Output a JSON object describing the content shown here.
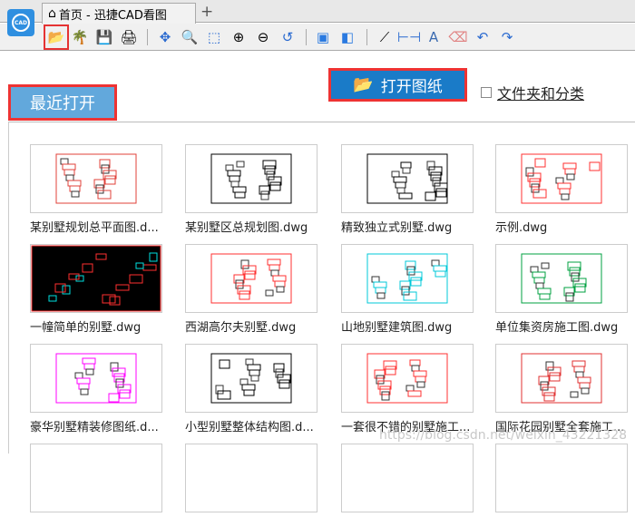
{
  "app": {
    "logo_text": "CAD",
    "tab_title": "首页 - 迅捷CAD看图",
    "add_tab": "+"
  },
  "toolbar": [
    "open-file",
    "palm-tree",
    "save",
    "print",
    "pan",
    "zoom-window",
    "zoom-extents",
    "zoom-in",
    "zoom-out",
    "zoom-previous",
    "3d-box",
    "3d-view",
    "line-measure",
    "dimension",
    "text",
    "eraser",
    "undo",
    "redo"
  ],
  "recent_label": "最近打开",
  "open_button": "打开图纸",
  "folder_checkbox": {
    "label": "文件夹和分类",
    "checked": false
  },
  "files": [
    {
      "name": "某别墅规划总平面图.d...",
      "bg": "#ffffff",
      "color": "#e0403a"
    },
    {
      "name": "某别墅区总规划图.dwg",
      "bg": "#ffffff",
      "color": "#000000"
    },
    {
      "name": "精致独立式别墅.dwg",
      "bg": "#ffffff",
      "color": "#000000"
    },
    {
      "name": "示例.dwg",
      "bg": "#ffffff",
      "color": "#ff3030"
    },
    {
      "name": "一幢简单的别墅.dwg",
      "bg": "#000000",
      "color": "#ff3030"
    },
    {
      "name": "西湖高尔夫别墅.dwg",
      "bg": "#ffffff",
      "color": "#ff3030"
    },
    {
      "name": "山地别墅建筑图.dwg",
      "bg": "#ffffff",
      "color": "#00c8d8"
    },
    {
      "name": "单位集资房施工图.dwg",
      "bg": "#ffffff",
      "color": "#00a040"
    },
    {
      "name": "豪华别墅精装修图纸.d...",
      "bg": "#ffffff",
      "color": "#ff00ff"
    },
    {
      "name": "小型别墅整体结构图.d...",
      "bg": "#ffffff",
      "color": "#000000"
    },
    {
      "name": "一套很不错的别墅施工...",
      "bg": "#ffffff",
      "color": "#ff3030"
    },
    {
      "name": "国际花园别墅全套施工...",
      "bg": "#ffffff",
      "color": "#e03030"
    },
    {
      "name": "",
      "bg": "#ffffff",
      "color": "#000000"
    },
    {
      "name": "",
      "bg": "#ffffff",
      "color": "#000000"
    },
    {
      "name": "",
      "bg": "#ffffff",
      "color": "#000000"
    },
    {
      "name": "",
      "bg": "#ffffff",
      "color": "#000000"
    }
  ],
  "watermark": "https://blog.csdn.net/weixin_43221328"
}
